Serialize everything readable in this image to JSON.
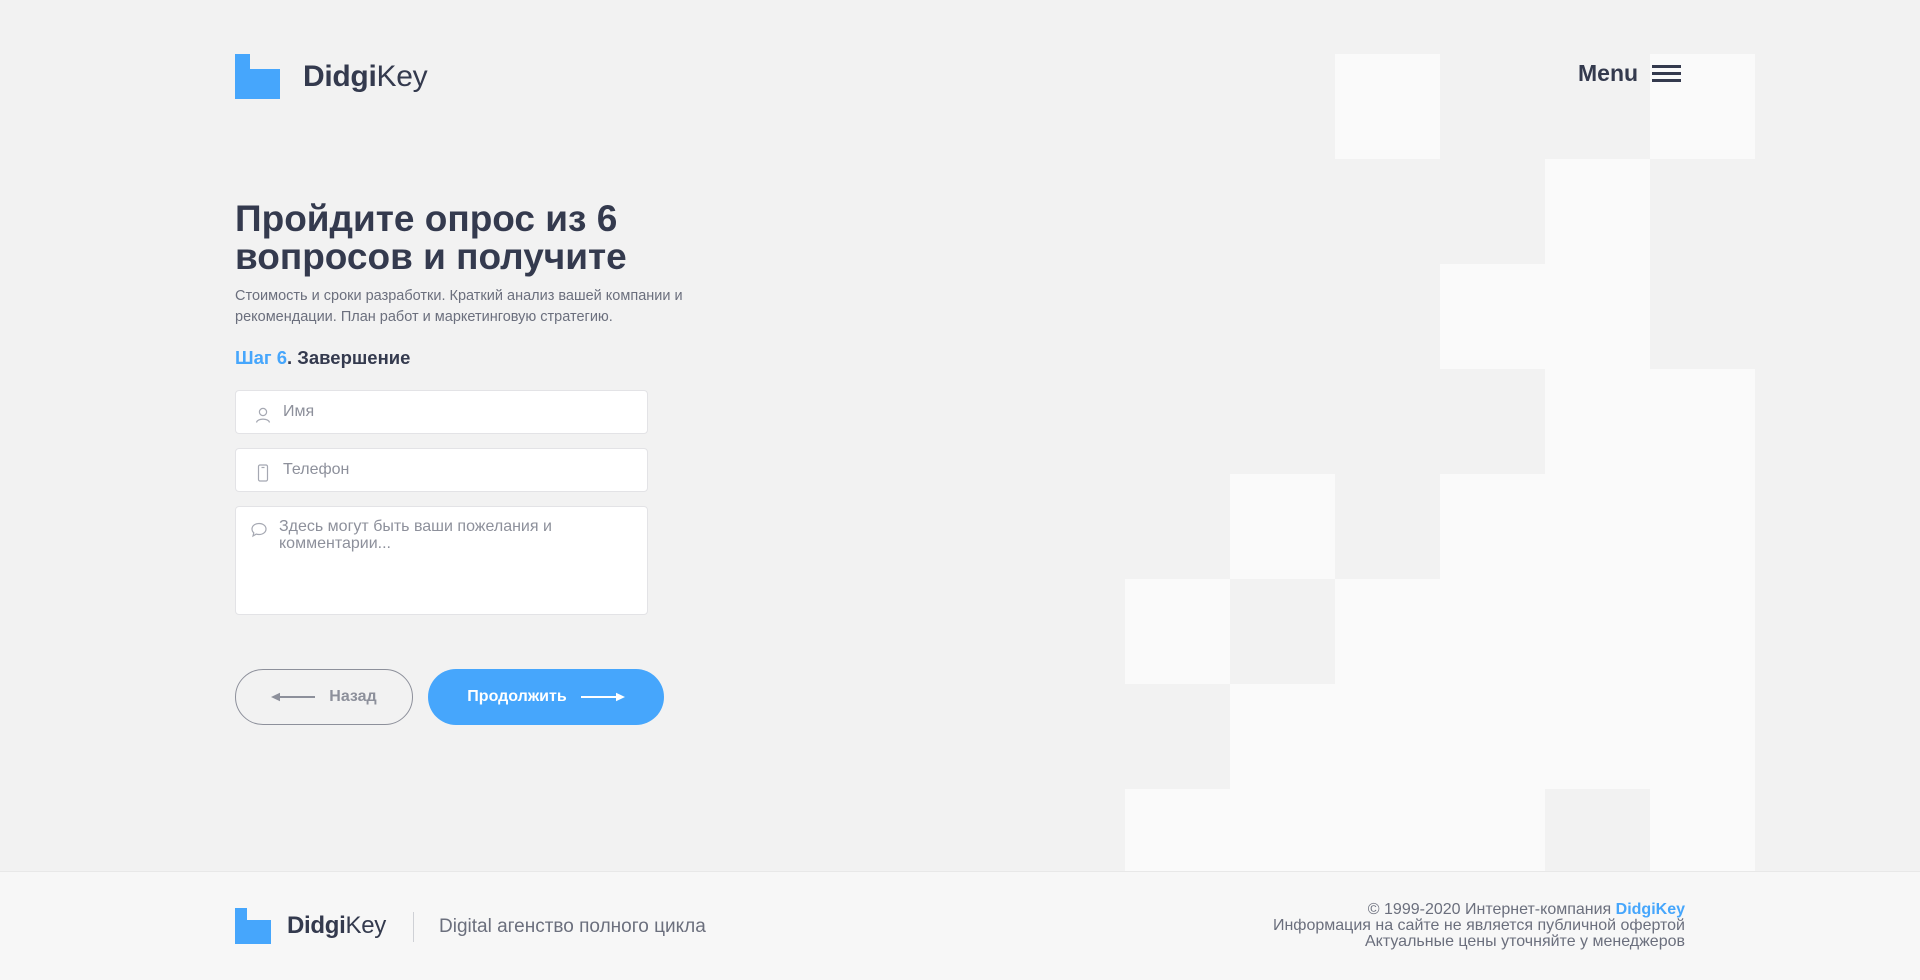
{
  "header": {
    "logo_bold": "Didgi",
    "logo_light": "Key",
    "menu_label": "Menu"
  },
  "hero": {
    "title": "Пройдите опрос из 6 вопросов и получите",
    "subtitle": "Стоимость и сроки разработки. Краткий анализ вашей компании и рекомендации. План работ и маркетинговую стратегию."
  },
  "step": {
    "number_label": "Шаг 6",
    "title": ". Завершение"
  },
  "form": {
    "name_placeholder": "Имя",
    "phone_placeholder": "Телефон",
    "comment_placeholder": "Здесь могут быть ваши пожелания и комментарии..."
  },
  "buttons": {
    "back_label": "Назад",
    "next_label": "Продолжить"
  },
  "footer": {
    "logo_bold": "Didgi",
    "logo_light": "Key",
    "tagline": "Digital агенство полного цикла",
    "copyright_prefix": "© 1999-2020 Интернет-компания ",
    "copyright_brand": "DidgiKey",
    "disclaimer": "Информация на сайте не является публичной офертой",
    "prices_note": "Актуальные цены уточняйте у менеджеров"
  },
  "colors": {
    "accent": "#46a6fc",
    "text_dark": "#343a4e",
    "text_muted": "#6b6f7d",
    "page_bg": "#f2f2f2",
    "checker_light": "#fafafa"
  },
  "icons": [
    "logo-mark-icon",
    "menu-burger-icon",
    "user-icon",
    "phone-icon",
    "comment-icon",
    "arrow-left-icon",
    "arrow-right-icon"
  ]
}
